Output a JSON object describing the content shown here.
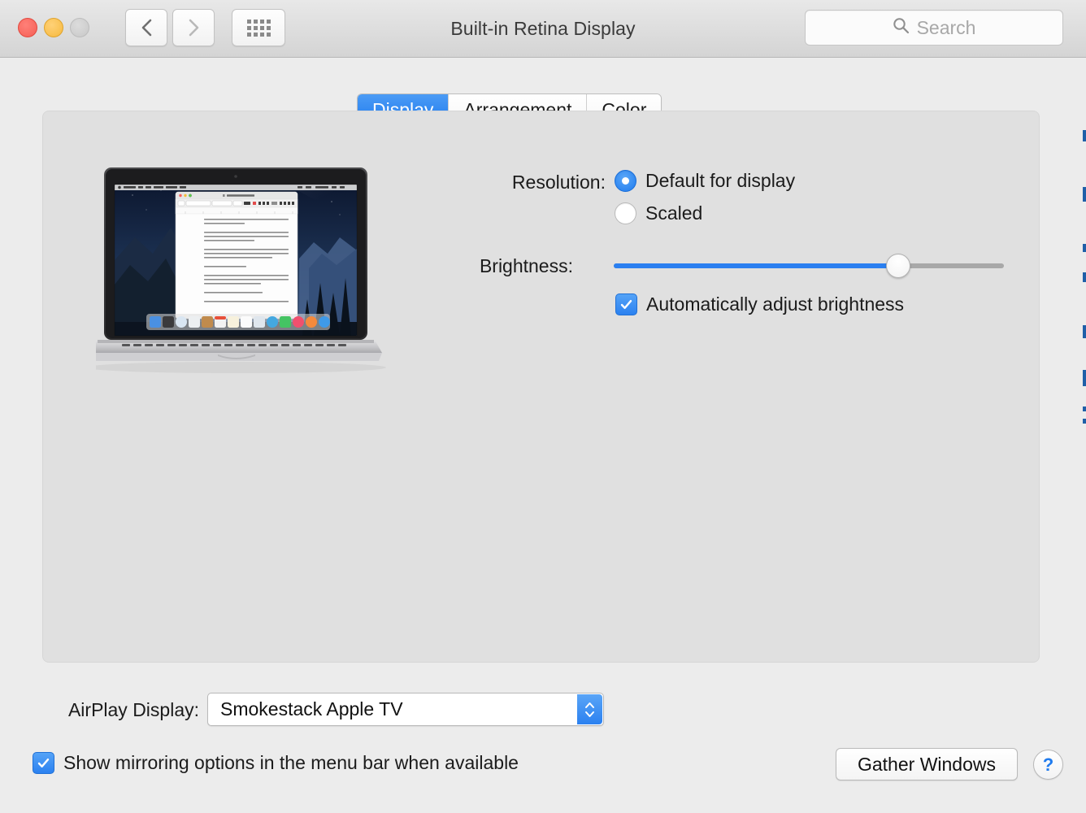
{
  "window": {
    "title": "Built-in Retina Display",
    "traffic_lights": [
      "close",
      "minimize",
      "zoom"
    ],
    "back_icon": "chevron-left-icon",
    "forward_icon": "chevron-right-icon",
    "grid_icon": "show-all-grid-icon"
  },
  "search": {
    "placeholder": "Search",
    "value": "",
    "icon": "search-icon"
  },
  "tabs": [
    {
      "label": "Display",
      "active": true
    },
    {
      "label": "Arrangement",
      "active": false
    },
    {
      "label": "Color",
      "active": false
    }
  ],
  "resolution": {
    "label": "Resolution:",
    "options": [
      {
        "label": "Default for display",
        "selected": true
      },
      {
        "label": "Scaled",
        "selected": false
      }
    ]
  },
  "brightness": {
    "label": "Brightness:",
    "value_percent": 73,
    "track_color": "#a8a8a8",
    "fill_color": "#2a7ff0",
    "auto_adjust": {
      "label": "Automatically adjust brightness",
      "checked": true
    }
  },
  "preview": {
    "device": "MacBook Pro Retina",
    "wallpaper": "OS X Yosemite Half Dome",
    "foreground_window": "Think Different.rtf",
    "app": "TextEdit",
    "menu_items": [
      "TextEdit",
      "File",
      "Edit",
      "Format",
      "Window",
      "Help"
    ],
    "document_paragraphs": [
      "Here's to the crazy ones. The misfits. The rebels. The troublemakers. The round pegs in the square holes.",
      "The ones who see things differently. They're not fond of rules. And they have no respect for the status quo. You can quote them, disagree with them, glorify or vilify them.",
      "But the only thing you can't do is ignore them. Because they change things. They invent. They imagine. They heal. They explore. They create. They inspire. They push the human race forward.",
      "Maybe they have to be crazy.",
      "How else can you stare at an empty canvas and see a work of art? Or sit in silence and hear a song that's never been written? Or gaze at a red planet and see a laboratory on wheels?",
      "We make tools for these kinds of people.",
      "While some see them as the crazy ones, we see genius. Because the"
    ],
    "font_name": "Helvetica Neue",
    "font_style": "Regular"
  },
  "airplay": {
    "label": "AirPlay Display:",
    "selected": "Smokestack Apple TV",
    "stepper_icon": "stepper-up-down-icon"
  },
  "mirroring": {
    "label": "Show mirroring options in the menu bar when available",
    "checked": true
  },
  "buttons": {
    "gather_windows": "Gather Windows",
    "help": "?"
  },
  "colors": {
    "accent_blue": "#2b81f0",
    "window_chrome": "#e8e8e8",
    "panel_bg": "#e0e0e0",
    "page_bg": "#ececec"
  }
}
